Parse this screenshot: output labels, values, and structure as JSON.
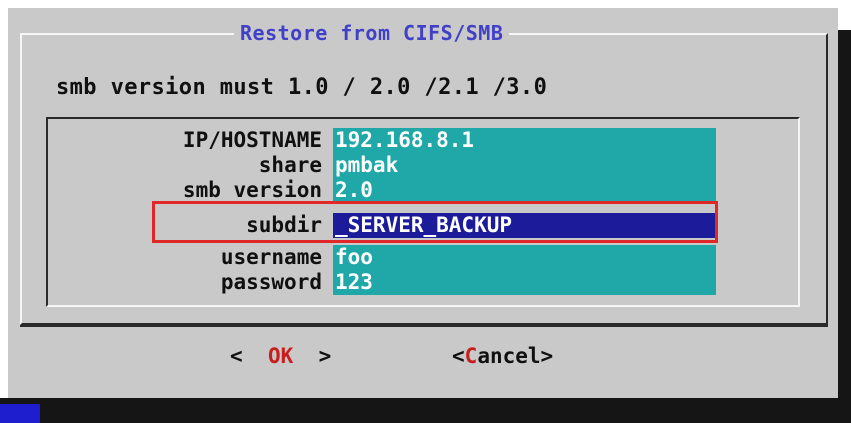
{
  "dialog": {
    "title": "Restore from CIFS/SMB",
    "message": "smb version must 1.0 / 2.0 /2.1 /3.0"
  },
  "form": {
    "fields": [
      {
        "label": "IP/HOSTNAME",
        "value": "192.168.8.1",
        "active": false
      },
      {
        "label": "share",
        "value": "pmbak",
        "active": false
      },
      {
        "label": "smb version",
        "value": "2.0",
        "active": false
      },
      {
        "label": "subdir",
        "value": "_SERVER_BACKUP",
        "active": true
      },
      {
        "label": "username",
        "value": "foo",
        "active": false
      },
      {
        "label": "password",
        "value": "123",
        "active": false
      }
    ]
  },
  "buttons": {
    "ok": {
      "open": "<",
      "hotkey": "O",
      "rest": "K",
      "close": ">"
    },
    "cancel": {
      "open": "<",
      "hotkey": "C",
      "rest": "ancel",
      "close": ">"
    }
  },
  "colors": {
    "dialog_bg": "#c9c9c9",
    "title": "#4040c8",
    "field_bg": "#20a8a8",
    "field_active_bg": "#1c1c9a",
    "highlight_box": "#e02828",
    "hotkey": "#c81e1e"
  }
}
